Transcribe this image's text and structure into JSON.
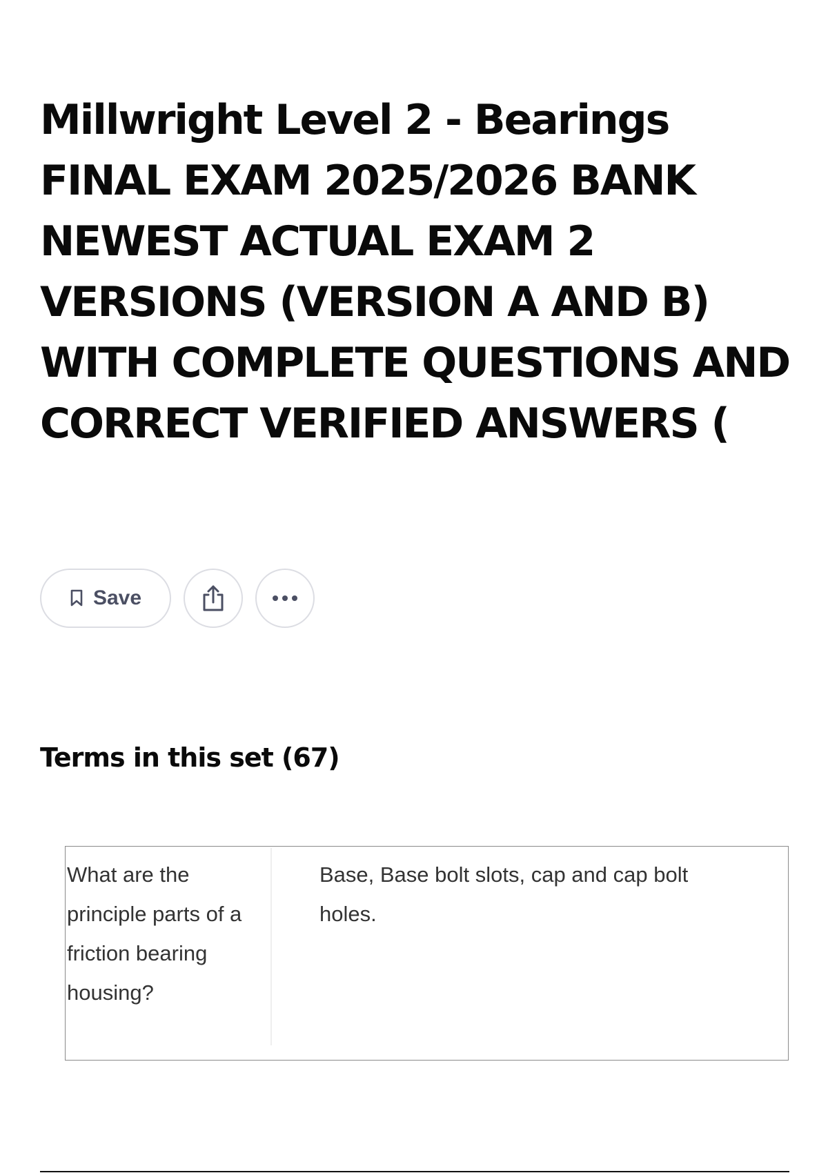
{
  "page": {
    "title": "Millwright Level 2 - Bearings FINAL EXAM 2025/2026 BANK NEWEST ACTUAL EXAM 2 VERSIONS (VERSION A AND B) WITH COMPLETE QUESTIONS AND CORRECT VERIFIED ANSWERS ("
  },
  "actions": {
    "save_label": "Save",
    "save_icon": "bookmark-icon",
    "share_icon": "share-icon",
    "more_icon": "more-horizontal-icon",
    "icon_color": "#4b4f63",
    "border_color": "#dcdde3"
  },
  "terms": {
    "heading": "Terms in this set (67)",
    "items": [
      {
        "term": "What are the principle parts of a friction bearing housing?",
        "definition": "Base, Base bolt slots, cap and cap bolt holes."
      }
    ]
  }
}
